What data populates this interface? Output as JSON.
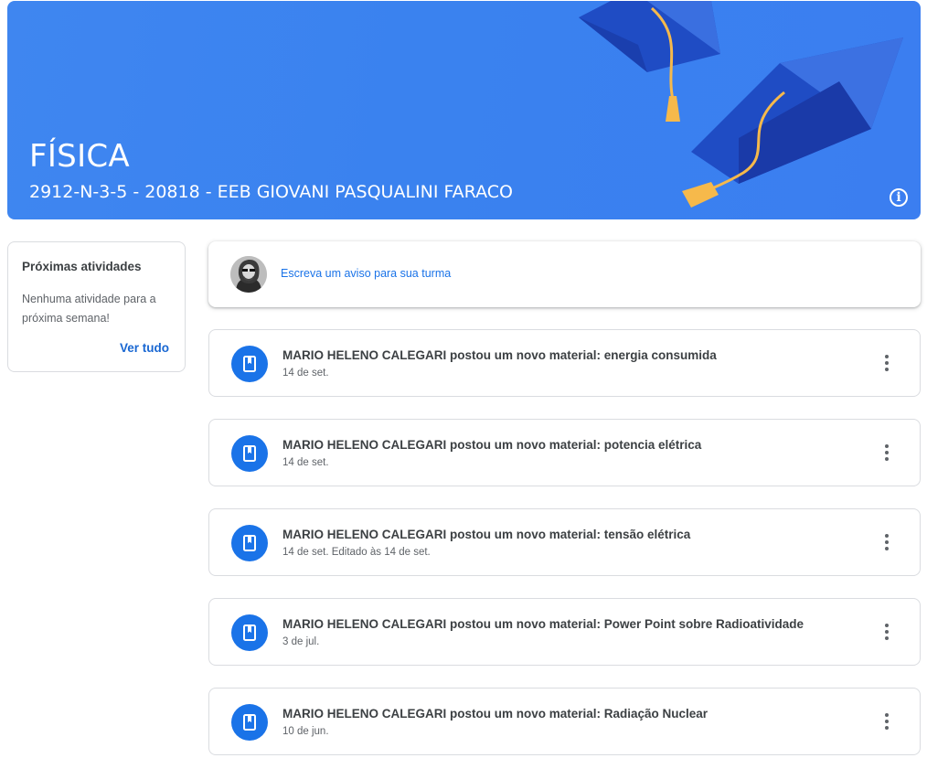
{
  "banner": {
    "title": "FÍSICA",
    "subtitle": "2912-N-3-5 - 20818 - EEB GIOVANI PASQUALINI FARACO",
    "info_glyph": "i",
    "info_icon": "info-icon",
    "color": "#3a82ef"
  },
  "upcoming": {
    "title": "Próximas atividades",
    "empty_text": "Nenhuma atividade para a próxima semana!",
    "view_all": "Ver tudo"
  },
  "announcement": {
    "placeholder": "Escreva um aviso para sua turma",
    "avatar_icon": "user-avatar"
  },
  "posts": [
    {
      "title": "MARIO HELENO CALEGARI postou um novo material: energia consumida",
      "date": "14 de set."
    },
    {
      "title": "MARIO HELENO CALEGARI postou um novo material: potencia elétrica",
      "date": "14 de set."
    },
    {
      "title": "MARIO HELENO CALEGARI postou um novo material: tensão elétrica",
      "date": "14 de set. Editado às 14 de set."
    },
    {
      "title": "MARIO HELENO CALEGARI postou um novo material: Power Point sobre Radioatividade",
      "date": "3 de jul."
    },
    {
      "title": "MARIO HELENO CALEGARI postou um novo material: Radiação Nuclear",
      "date": "10 de jun."
    }
  ],
  "icons": {
    "material": "book-icon",
    "more": "more-vert-icon"
  },
  "colors": {
    "accent": "#1a73e8",
    "link": "#1967d2"
  }
}
